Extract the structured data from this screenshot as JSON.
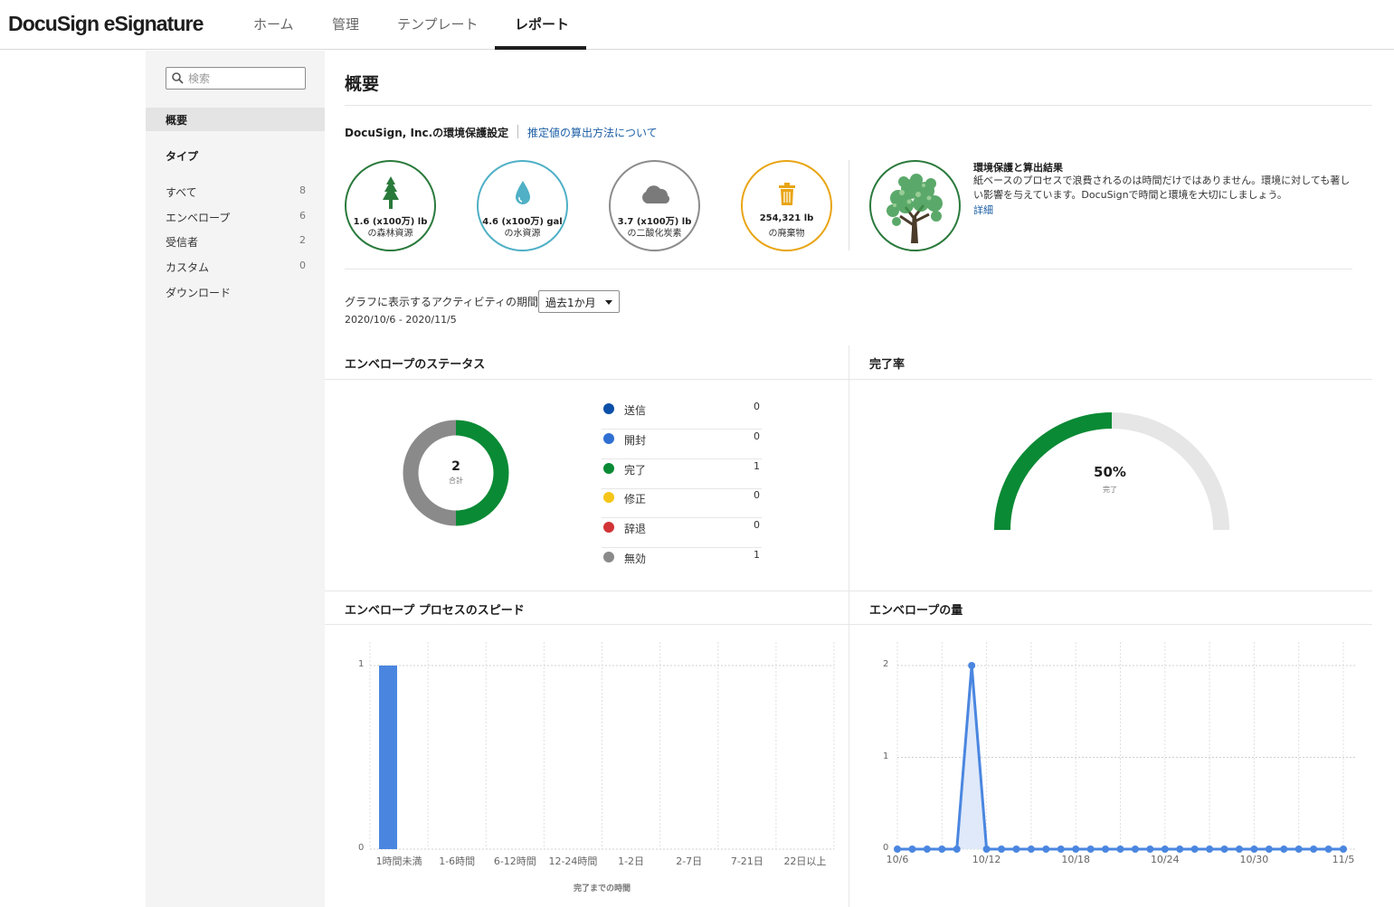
{
  "header": {
    "logo": "DocuSign eSignature",
    "tabs": [
      {
        "label": "ホーム",
        "active": false
      },
      {
        "label": "管理",
        "active": false
      },
      {
        "label": "テンプレート",
        "active": false
      },
      {
        "label": "レポート",
        "active": true
      }
    ]
  },
  "sidebar": {
    "search_placeholder": "検索",
    "overview": "概要",
    "type_heading": "タイプ",
    "items": [
      {
        "label": "すべて",
        "count": "8"
      },
      {
        "label": "エンベロープ",
        "count": "6"
      },
      {
        "label": "受信者",
        "count": "2"
      },
      {
        "label": "カスタム",
        "count": "0"
      },
      {
        "label": "ダウンロード",
        "count": ""
      }
    ]
  },
  "main": {
    "title": "概要",
    "env": {
      "title": "DocuSign, Inc.の環境保護設定",
      "link": "推定値の算出方法について",
      "stats": [
        {
          "value": "1.6 (x100万) lb",
          "label": "の森林資源",
          "color": "#2a7a3c",
          "icon": "tree-icon"
        },
        {
          "value": "4.6 (x100万) gal",
          "label": "の水資源",
          "color": "#4fb0c6",
          "icon": "water-drop-icon"
        },
        {
          "value": "3.7 (x100万) lb",
          "label": "の二酸化炭素",
          "color": "#8c8c8c",
          "icon": "cloud-icon"
        },
        {
          "value": "254,321 lb",
          "label": "の廃棄物",
          "color": "#e8a515",
          "icon": "trash-icon"
        }
      ],
      "impact_title": "環境保護と算出結果",
      "impact_text": "紙ベースのプロセスで浪費されるのは時間だけではありません。環境に対しても著しい影響を与えています。DocuSignで時間と環境を大切にしましょう。",
      "impact_link": "詳細"
    },
    "period": {
      "label": "グラフに表示するアクティビティの期間",
      "selected": "過去1か月",
      "range": "2020/10/6 - 2020/11/5"
    },
    "status_panel": {
      "title": "エンベロープのステータス",
      "total": "2",
      "total_label": "合計",
      "legend": [
        {
          "label": "送信",
          "value": "0",
          "color": "#0b4fa8"
        },
        {
          "label": "開封",
          "value": "0",
          "color": "#2f6fd2"
        },
        {
          "label": "完了",
          "value": "1",
          "color": "#0a8a35"
        },
        {
          "label": "修正",
          "value": "0",
          "color": "#f5c518"
        },
        {
          "label": "辞退",
          "value": "0",
          "color": "#d13438"
        },
        {
          "label": "無効",
          "value": "1",
          "color": "#8a8a8a"
        }
      ]
    },
    "completion_panel": {
      "title": "完了率",
      "percent": "50%",
      "percent_value": 0.5,
      "label": "完了"
    },
    "speed_panel": {
      "title": "エンベロープ プロセスのスピード"
    },
    "volume_panel": {
      "title": "エンベロープの量"
    }
  },
  "chart_data": [
    {
      "type": "pie",
      "categories": [
        "送信",
        "開封",
        "完了",
        "修正",
        "辞退",
        "無効"
      ],
      "values": [
        0,
        0,
        1,
        0,
        0,
        1
      ],
      "total": 2
    },
    {
      "type": "bar",
      "categories": [
        "1時間未満",
        "1-6時間",
        "6-12時間",
        "12-24時間",
        "1-2日",
        "2-7日",
        "7-21日",
        "22日以上"
      ],
      "values": [
        1,
        0,
        0,
        0,
        0,
        0,
        0,
        0
      ],
      "xlabel": "完了までの時間",
      "ylim": [
        0,
        1
      ],
      "yticks": [
        "0",
        "1"
      ],
      "grid": true
    },
    {
      "type": "area",
      "x": [
        "10/6",
        "10/7",
        "10/8",
        "10/9",
        "10/10",
        "10/11",
        "10/12",
        "10/13",
        "10/14",
        "10/15",
        "10/16",
        "10/17",
        "10/18",
        "10/19",
        "10/20",
        "10/21",
        "10/22",
        "10/23",
        "10/24",
        "10/25",
        "10/26",
        "10/27",
        "10/28",
        "10/29",
        "10/30",
        "10/31",
        "11/1",
        "11/2",
        "11/3",
        "11/4",
        "11/5"
      ],
      "values": [
        0,
        0,
        0,
        0,
        0,
        2,
        0,
        0,
        0,
        0,
        0,
        0,
        0,
        0,
        0,
        0,
        0,
        0,
        0,
        0,
        0,
        0,
        0,
        0,
        0,
        0,
        0,
        0,
        0,
        0,
        0
      ],
      "xticks": [
        "10/6",
        "10/12",
        "10/18",
        "10/24",
        "10/30",
        "11/5"
      ],
      "ylim": [
        0,
        2
      ],
      "yticks": [
        "0",
        "1",
        "2"
      ],
      "grid": true
    }
  ]
}
